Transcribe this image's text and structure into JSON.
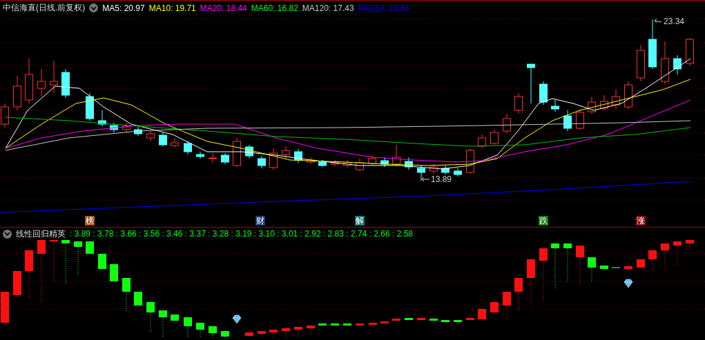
{
  "chart_header": {
    "title": "中信海直(日线.前复权)",
    "indicators": [
      {
        "label": "MA5: 20.97",
        "color": "#ffffff"
      },
      {
        "label": "MA10: 19.71",
        "color": "#ffff00"
      },
      {
        "label": "MA20: 18.44",
        "color": "#ff00ff"
      },
      {
        "label": "MA60: 16.82",
        "color": "#00ff00"
      },
      {
        "label": "MA120: 17.43",
        "color": "#c8c8c8"
      },
      {
        "label": "MA250: 13.66",
        "color": "#0000ff"
      }
    ]
  },
  "price_labels": {
    "high": "23.34",
    "low": "13.89"
  },
  "event_markers": [
    {
      "label": "榜",
      "color": "#a0521a"
    },
    {
      "label": "财",
      "color": "#1a3a7a"
    },
    {
      "label": "解",
      "color": "#1a7070"
    },
    {
      "label": "跌",
      "color": "#107a10"
    },
    {
      "label": "涨",
      "color": "#8a0a0a"
    }
  ],
  "indicator_panel": {
    "title": "线性回归精英",
    "values": [
      ": 3.89",
      ": 3.78",
      ": 3.66",
      ": 3.56",
      ": 3.46",
      ": 3.37",
      ": 3.28",
      ": 3.19",
      ": 3.10",
      ": 3.01",
      ": 2.92",
      ": 2.83",
      ": 2.74",
      ": 2.66",
      ": 2.58"
    ]
  }
}
